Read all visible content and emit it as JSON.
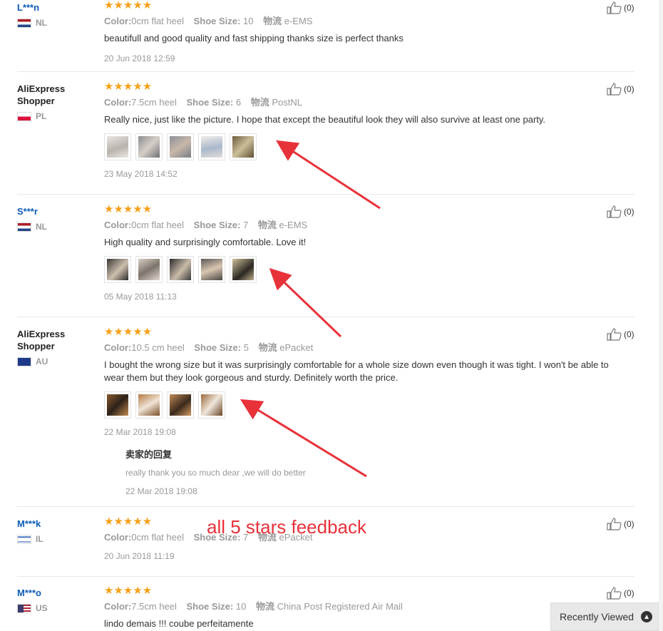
{
  "labels": {
    "color": "Color:",
    "shoe_size": "Shoe Size:",
    "shipping": "物流"
  },
  "reviews": [
    {
      "user": "L***n",
      "country": "NL",
      "stars": "★★★★★",
      "color": "0cm flat heel",
      "size": "10",
      "shipping": "e-EMS",
      "text": "beautifull and good quality and fast shipping thanks size is perfect thanks",
      "date": "20 Jun 2018 12:59",
      "likes": "(0)",
      "photos": 0
    },
    {
      "user": "AliExpress Shopper",
      "country": "PL",
      "stars": "★★★★★",
      "color": "7.5cm heel",
      "size": "6",
      "shipping": "PostNL",
      "text": "Really nice, just like the picture. I hope that except the beautiful look they will also survive at least one party.",
      "date": "23 May 2018 14:52",
      "likes": "(0)",
      "photos": 5
    },
    {
      "user": "S***r",
      "country": "NL",
      "stars": "★★★★★",
      "color": "0cm flat heel",
      "size": "7",
      "shipping": "e-EMS",
      "text": "High quality and surprisingly comfortable. Love it!",
      "date": "05 May 2018 11:13",
      "likes": "(0)",
      "photos": 5
    },
    {
      "user": "AliExpress Shopper",
      "country": "AU",
      "stars": "★★★★★",
      "color": "10.5 cm heel",
      "size": "5",
      "shipping": "ePacket",
      "text": "I bought the wrong size but it was surprisingly comfortable for a whole size down even though it was tight. I won't be able to wear them but they look gorgeous and sturdy. Definitely worth the price.",
      "date": "22 Mar 2018 19:08",
      "likes": "(0)",
      "photos": 4,
      "reply": {
        "title": "卖家的回复",
        "text": "really thank you so much dear ,we will do better",
        "date": "22 Mar 2018 19:08"
      }
    },
    {
      "user": "M***k",
      "country": "IL",
      "stars": "★★★★★",
      "color": "0cm flat heel",
      "size": "7",
      "shipping": "ePacket",
      "text": "",
      "date": "20 Jun 2018 11:19",
      "likes": "(0)",
      "photos": 0
    },
    {
      "user": "M***o",
      "country": "US",
      "stars": "★★★★★",
      "color": "7.5cm heel",
      "size": "10",
      "shipping": "China Post Registered Air Mail",
      "text": "lindo demais !!! coube perfeitamente",
      "date": "",
      "likes": "(0)",
      "photos": 0
    }
  ],
  "annotation": "all 5 stars feedback",
  "recently_viewed": {
    "label": "Recently Viewed",
    "icon": "chevron-up-icon"
  },
  "colors": {
    "star": "#f6a01a",
    "link": "#0c5bb6",
    "annotation": "#e8323a"
  }
}
